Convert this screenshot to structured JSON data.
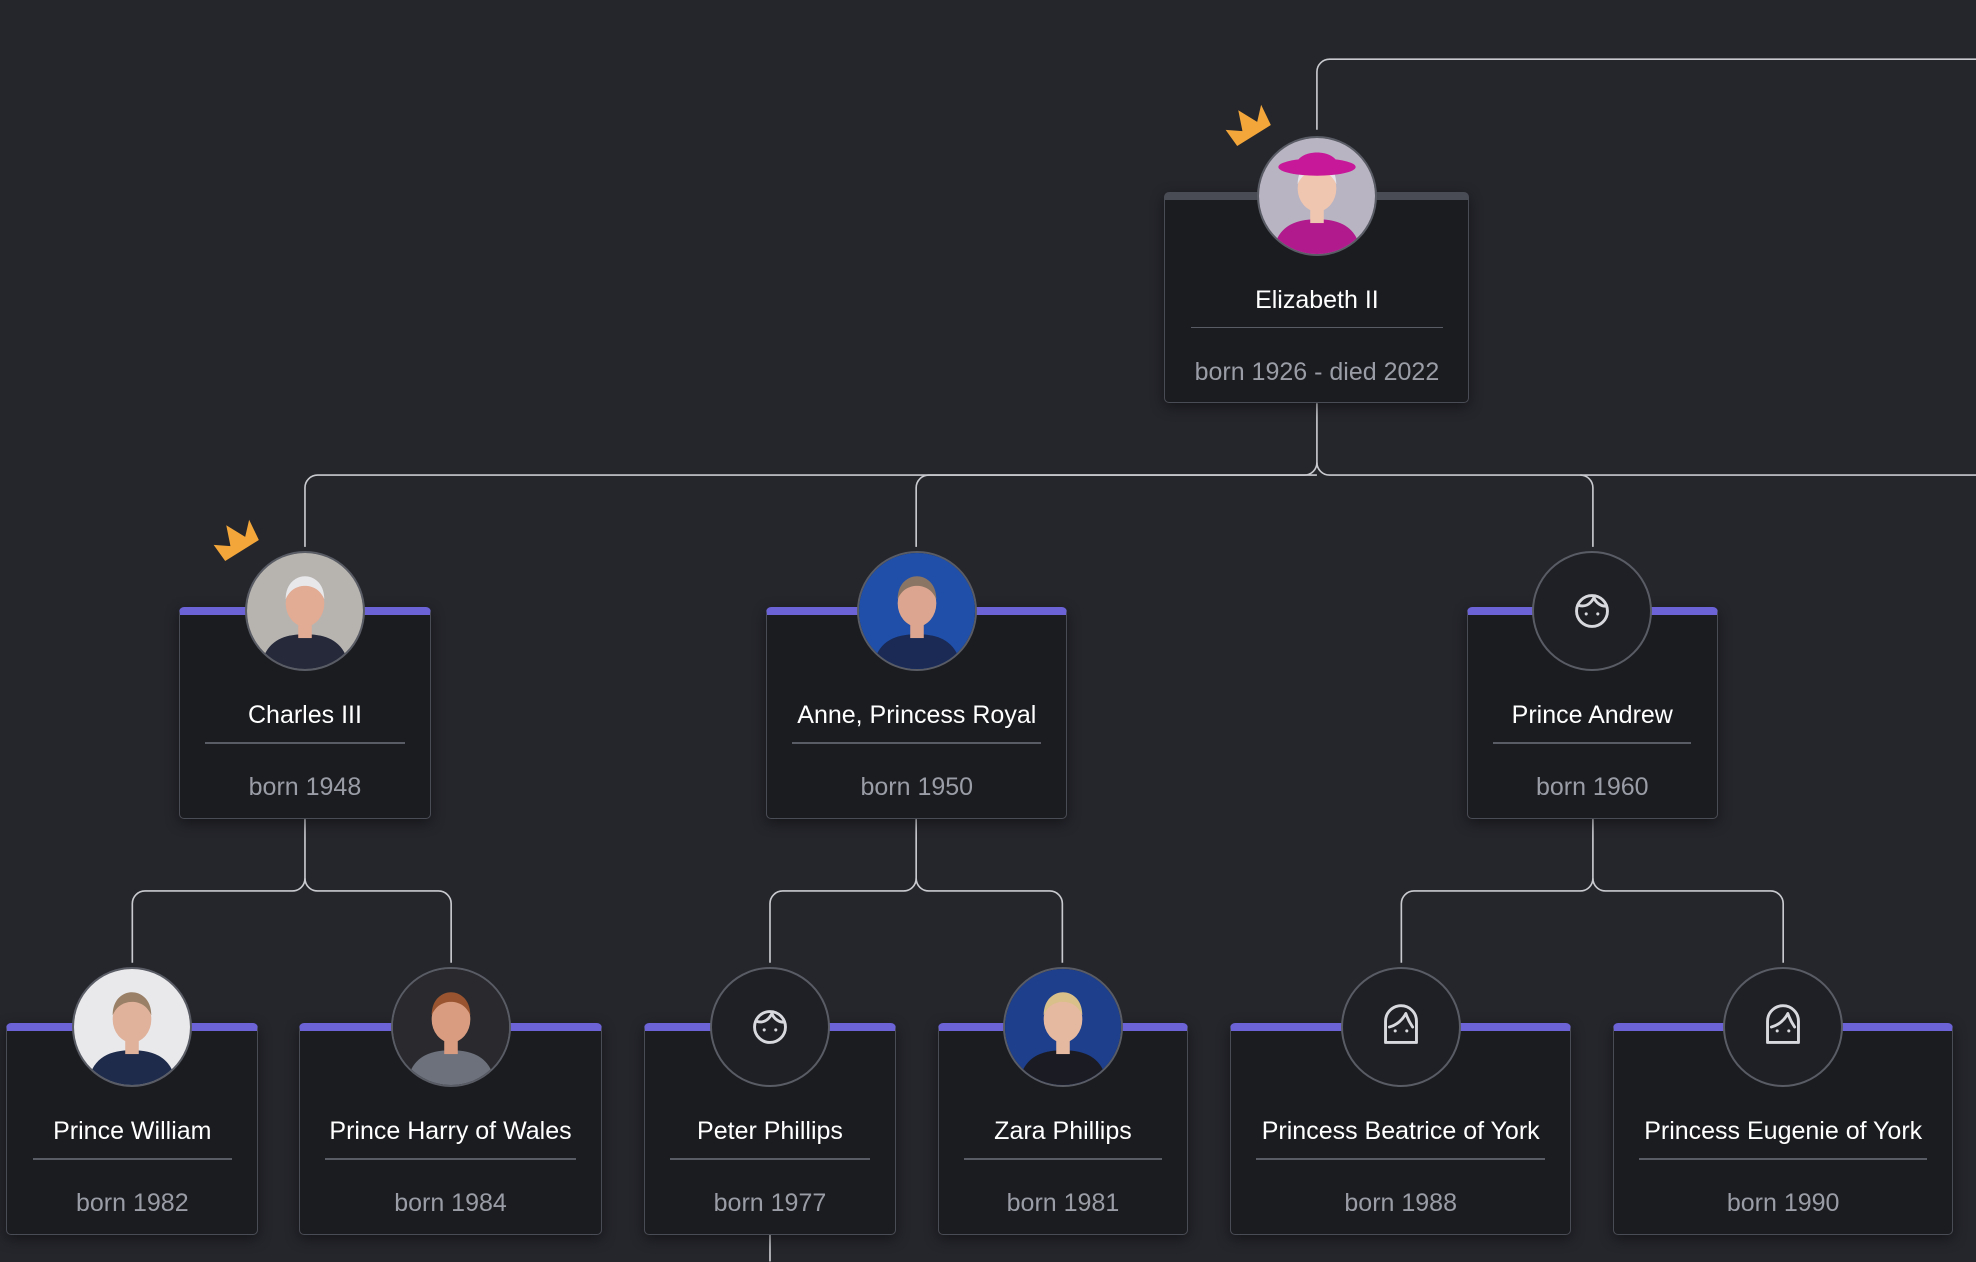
{
  "tree": {
    "people": [
      {
        "id": "elizabeth",
        "name": "Elizabeth II",
        "dates": "born 1926 - died 2022",
        "avatar": "photo",
        "crown": true,
        "photo_colors": {
          "bg": "#b9b4c2",
          "clothing": "#b01a8c",
          "hat": "#c8189a",
          "skin": "#efc6b0",
          "hair": "#e6e4e8"
        }
      },
      {
        "id": "charles",
        "name": "Charles III",
        "dates": "born 1948",
        "avatar": "photo",
        "crown": true,
        "photo_colors": {
          "bg": "#b7b4b0",
          "clothing": "#25293a",
          "hat": "",
          "skin": "#e1ab94",
          "hair": "#e8e8ea"
        }
      },
      {
        "id": "anne",
        "name": "Anne, Princess Royal",
        "dates": "born 1950",
        "avatar": "photo",
        "crown": false,
        "photo_colors": {
          "bg": "#1f4fa8",
          "clothing": "#1a2a55",
          "hat": "",
          "skin": "#dba58f",
          "hair": "#8a7565"
        }
      },
      {
        "id": "andrew",
        "name": "Prince Andrew",
        "dates": "born 1960",
        "avatar": "male-placeholder-icon",
        "crown": false
      },
      {
        "id": "william",
        "name": "Prince William",
        "dates": "born 1982",
        "avatar": "photo",
        "crown": false,
        "photo_colors": {
          "bg": "#e9e9ec",
          "clothing": "#1e2b4a",
          "hat": "",
          "skin": "#e0b29c",
          "hair": "#9a8066"
        }
      },
      {
        "id": "harry",
        "name": "Prince Harry of Wales",
        "dates": "born 1984",
        "avatar": "photo",
        "crown": false,
        "photo_colors": {
          "bg": "#2a2a2e",
          "clothing": "#6c717c",
          "hat": "",
          "skin": "#d99c80",
          "hair": "#9a5530"
        }
      },
      {
        "id": "peter",
        "name": "Peter Phillips",
        "dates": "born 1977",
        "avatar": "male-placeholder-icon",
        "crown": false
      },
      {
        "id": "zara",
        "name": "Zara Phillips",
        "dates": "born 1981",
        "avatar": "photo",
        "crown": false,
        "photo_colors": {
          "bg": "#1d3f8c",
          "clothing": "#1b1b24",
          "hat": "",
          "skin": "#e5b8a0",
          "hair": "#d9c08a"
        }
      },
      {
        "id": "beatrice",
        "name": "Princess Beatrice of York",
        "dates": "born 1988",
        "avatar": "female-placeholder-icon",
        "crown": false
      },
      {
        "id": "eugenie",
        "name": "Princess Eugenie of York",
        "dates": "born 1990",
        "avatar": "female-placeholder-icon",
        "crown": false
      }
    ]
  },
  "colors": {
    "background": "#25262c",
    "card": "#1b1c20",
    "card_border": "#4a4c55",
    "accent": "#6b63d6",
    "link": "#c9cad0",
    "crown": "#f3a73a",
    "name_text": "#ffffff",
    "date_text": "#9a9ca6"
  }
}
